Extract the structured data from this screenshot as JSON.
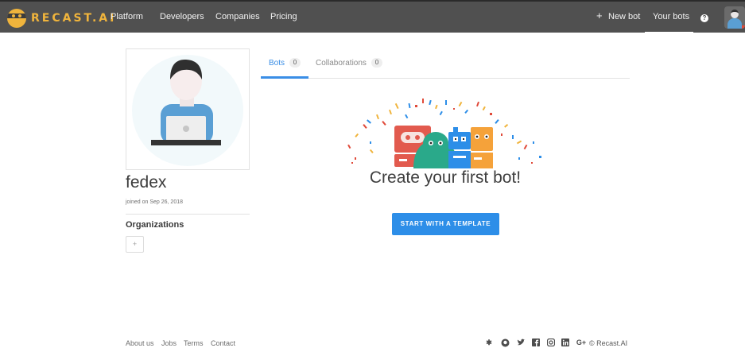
{
  "brand": {
    "name": "RECAST.AI",
    "accent": "#f0b43c"
  },
  "nav": {
    "items": [
      {
        "label": "Platform"
      },
      {
        "label": "Developers"
      },
      {
        "label": "Companies"
      },
      {
        "label": "Pricing"
      }
    ],
    "new_bot": "New bot",
    "your_bots": "Your bots",
    "help": "?"
  },
  "profile": {
    "username": "fedex",
    "joined": "joined on Sep 26, 2018",
    "organizations_title": "Organizations",
    "add_org": "+"
  },
  "tabs": [
    {
      "label": "Bots",
      "count": "0",
      "active": true
    },
    {
      "label": "Collaborations",
      "count": "0",
      "active": false
    }
  ],
  "main": {
    "empty_title": "Create your first bot!",
    "cta_label": "START WITH A TEMPLATE",
    "cta_color": "#2d8ee8"
  },
  "footer": {
    "links": [
      {
        "label": "About us"
      },
      {
        "label": "Jobs"
      },
      {
        "label": "Terms"
      },
      {
        "label": "Contact"
      }
    ],
    "social": [
      "slack-icon",
      "github-icon",
      "twitter-icon",
      "facebook-icon",
      "instagram-icon",
      "linkedin-icon",
      "google-plus-icon"
    ],
    "copyright": "© Recast.AI"
  }
}
